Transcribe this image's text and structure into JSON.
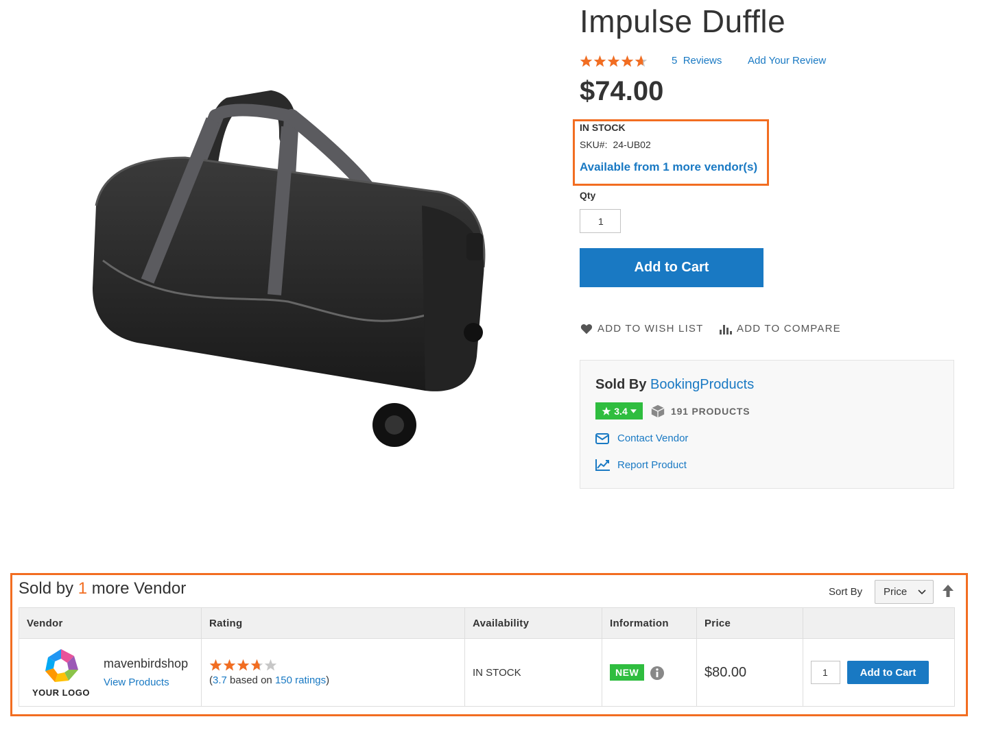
{
  "product": {
    "title": "Impulse Duffle",
    "rating_fraction": 0.93,
    "reviews_count": "5",
    "reviews_label": "Reviews",
    "add_review": "Add Your Review",
    "price": "$74.00",
    "stock": "IN STOCK",
    "sku_label": "SKU#:",
    "sku": "24-UB02",
    "more_vendors": "Available from 1 more vendor(s)",
    "qty_label": "Qty",
    "qty_value": "1",
    "add_to_cart": "Add to Cart",
    "wish_list": "ADD TO WISH LIST",
    "compare": "ADD TO COMPARE"
  },
  "seller": {
    "sold_by_label": "Sold By",
    "vendor_name": "BookingProducts",
    "rating": "3.4",
    "products": "191 PRODUCTS",
    "contact": "Contact Vendor",
    "report": "Report Product"
  },
  "other_vendors": {
    "title_prefix": "Sold by",
    "count": "1",
    "title_suffix": "more Vendor",
    "sort_label": "Sort By",
    "sort_value": "Price",
    "columns": [
      "Vendor",
      "Rating",
      "Availability",
      "Information",
      "Price",
      ""
    ],
    "rows": [
      {
        "logo_text": "YOUR LOGO",
        "vendor": "mavenbirdshop",
        "view_products": "View Products",
        "rating_fraction": 0.74,
        "rating_open": "(",
        "rating_value": "3.7",
        "rating_mid": "based on",
        "rating_count": "150 ratings",
        "rating_close": ")",
        "availability": "IN STOCK",
        "badge": "NEW",
        "price": "$80.00",
        "qty": "1",
        "add_to_cart": "Add to Cart"
      }
    ]
  },
  "colors": {
    "accent": "#1979c3",
    "highlight": "#f26d21",
    "badge_green": "#2fbd3f",
    "star": "#f26d21"
  }
}
